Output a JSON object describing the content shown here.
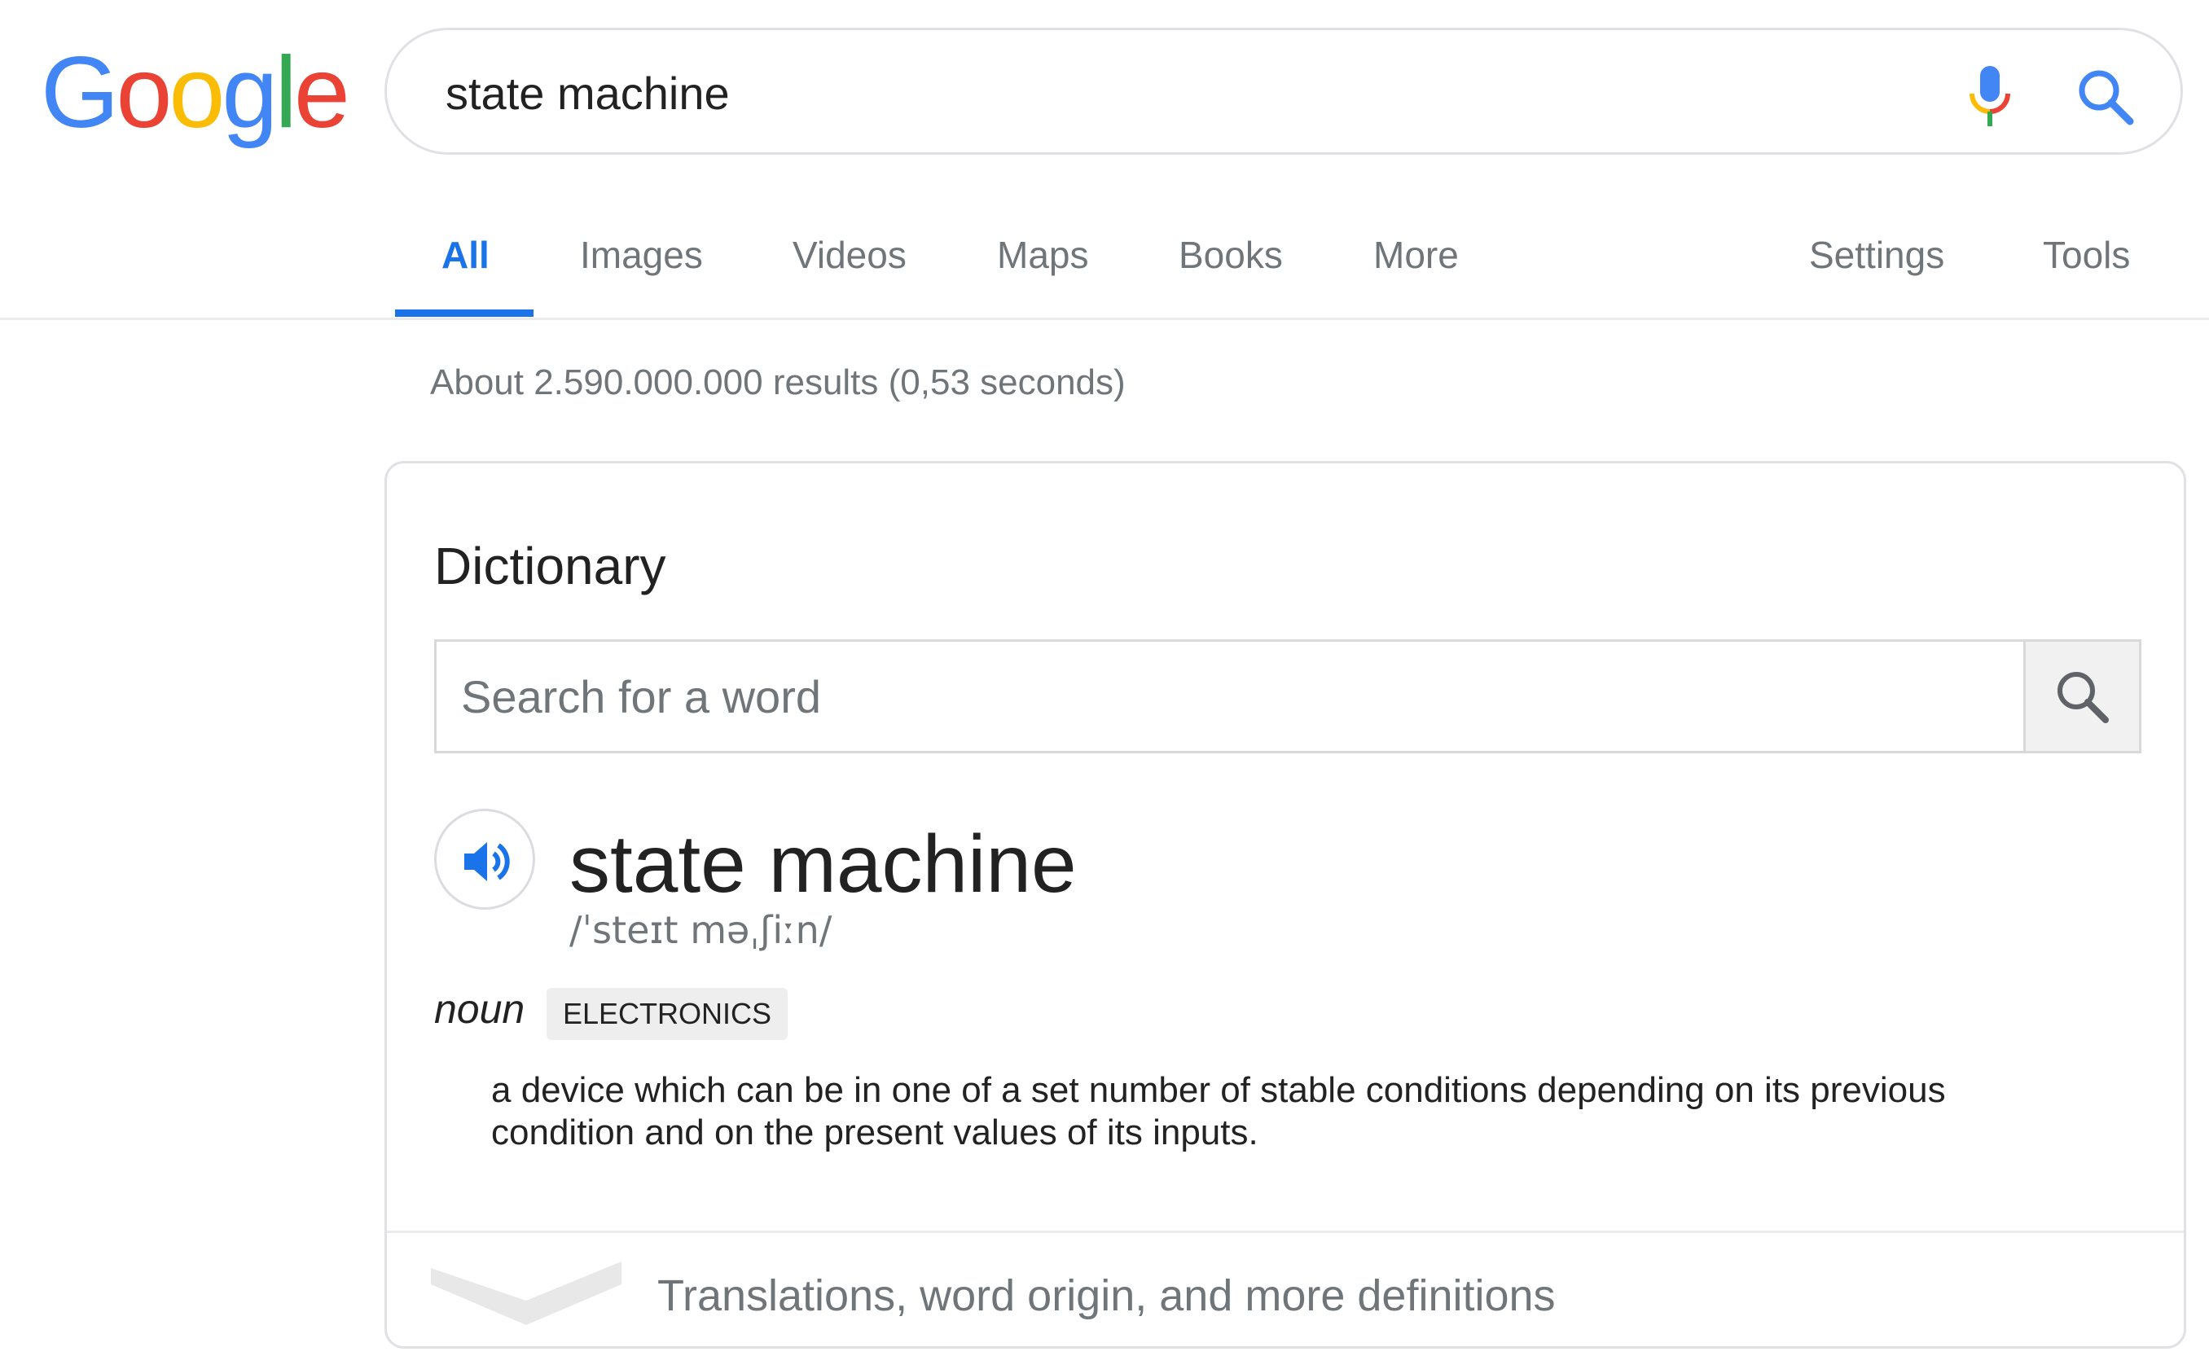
{
  "logo": {
    "letters": [
      {
        "ch": "G",
        "color": "#4285F4"
      },
      {
        "ch": "o",
        "color": "#EA4335"
      },
      {
        "ch": "o",
        "color": "#FBBC05"
      },
      {
        "ch": "g",
        "color": "#4285F4"
      },
      {
        "ch": "l",
        "color": "#34A853"
      },
      {
        "ch": "e",
        "color": "#EA4335"
      }
    ]
  },
  "search": {
    "query": "state machine",
    "mic_icon": "microphone-icon",
    "search_icon": "magnifier-icon"
  },
  "tabs": [
    {
      "label": "All",
      "active": true
    },
    {
      "label": "Images"
    },
    {
      "label": "Videos"
    },
    {
      "label": "Maps"
    },
    {
      "label": "Books"
    },
    {
      "label": "More"
    },
    {
      "label": "Settings"
    },
    {
      "label": "Tools"
    }
  ],
  "results_stats": "About 2.590.000.000 results (0,53 seconds)",
  "dictionary": {
    "title": "Dictionary",
    "search_placeholder": "Search for a word",
    "headword": "state machine",
    "phonetic": "/ˈsteɪt məˌʃiːn/",
    "part_of_speech": "noun",
    "domain_label": "ELECTRONICS",
    "definition": "a device which can be in one of a set number of stable conditions depending on its previous condition and on the present values of its inputs.",
    "more_link": "Translations, word origin, and more definitions"
  },
  "colors": {
    "accent_blue": "#1a73e8",
    "secondary_text": "#70757a",
    "border": "#dfe1e5"
  }
}
